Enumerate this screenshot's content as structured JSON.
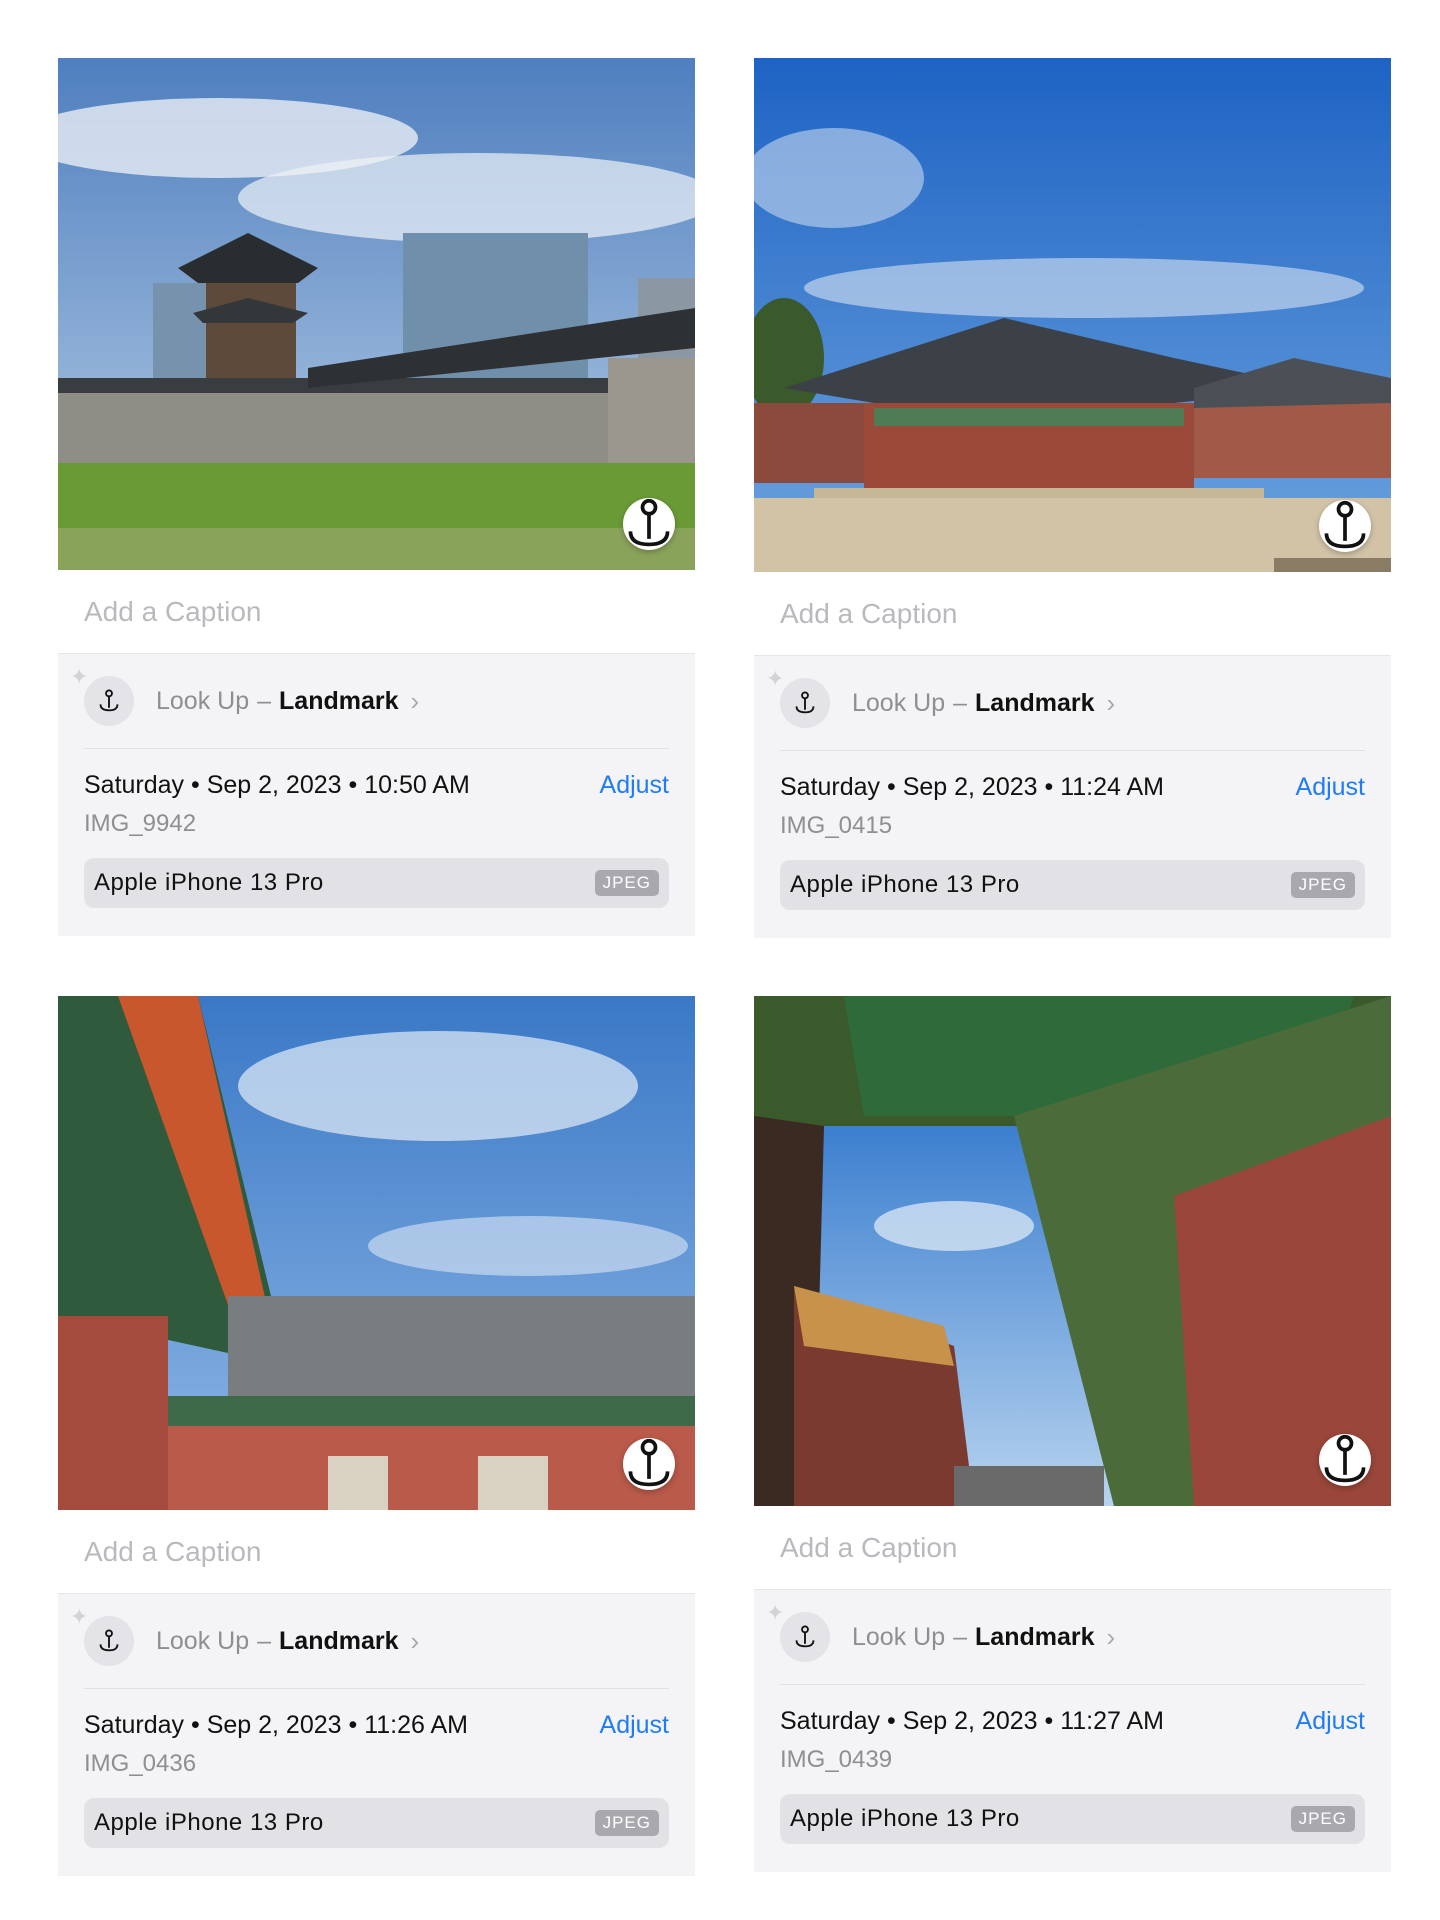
{
  "cards": [
    {
      "caption_placeholder": "Add a Caption",
      "lookup_prefix": "Look Up",
      "lookup_dash": "–",
      "lookup_subject": "Landmark",
      "date": "Saturday • Sep 2, 2023 • 10:50 AM",
      "adjust_label": "Adjust",
      "filename": "IMG_9942",
      "device": "Apple iPhone 13 Pro",
      "format": "JPEG"
    },
    {
      "caption_placeholder": "Add a Caption",
      "lookup_prefix": "Look Up",
      "lookup_dash": "–",
      "lookup_subject": "Landmark",
      "date": "Saturday • Sep 2, 2023 • 11:24 AM",
      "adjust_label": "Adjust",
      "filename": "IMG_0415",
      "device": "Apple iPhone 13 Pro",
      "format": "JPEG"
    },
    {
      "caption_placeholder": "Add a Caption",
      "lookup_prefix": "Look Up",
      "lookup_dash": "–",
      "lookup_subject": "Landmark",
      "date": "Saturday • Sep 2, 2023 • 11:26 AM",
      "adjust_label": "Adjust",
      "filename": "IMG_0436",
      "device": "Apple iPhone 13 Pro",
      "format": "JPEG"
    },
    {
      "caption_placeholder": "Add a Caption",
      "lookup_prefix": "Look Up",
      "lookup_dash": "–",
      "lookup_subject": "Landmark",
      "date": "Saturday • Sep 2, 2023 • 11:27 AM",
      "adjust_label": "Adjust",
      "filename": "IMG_0439",
      "device": "Apple iPhone 13 Pro",
      "format": "JPEG"
    }
  ],
  "colors": {
    "accent": "#1f7cf6",
    "info_bg": "#f4f4f6",
    "placeholder": "#b9b9be"
  },
  "icons": {
    "lookup": "landmark-lookup-icon",
    "sparkle": "sparkle-icon",
    "chevron": "chevron-right-icon"
  }
}
